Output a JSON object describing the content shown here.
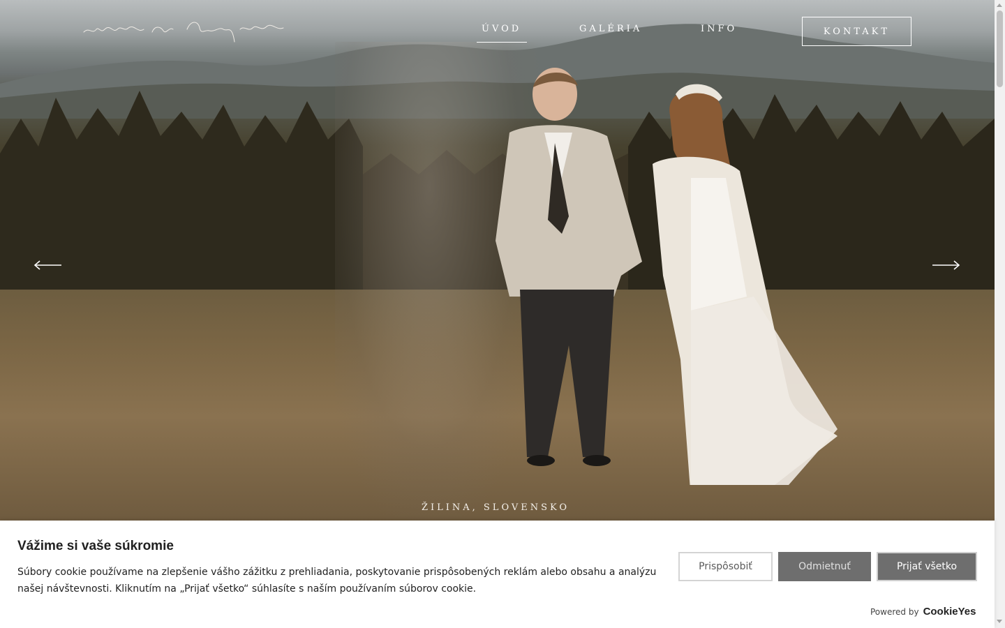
{
  "nav": {
    "logo_text": "marki na bregleu",
    "items": [
      {
        "label": "ÚVOD",
        "active": true
      },
      {
        "label": "GALÉRIA",
        "active": false
      },
      {
        "label": "INFO",
        "active": false
      }
    ],
    "cta": "KONTAKT"
  },
  "hero": {
    "location": "ŽILINA, SLOVENSKO",
    "prev_icon": "arrow-left-icon",
    "next_icon": "arrow-right-icon"
  },
  "cookie": {
    "title": "Vážime si vaše súkromie",
    "text": "Súbory cookie používame na zlepšenie vášho zážitku z prehliadania, poskytovanie prispôsobených reklám alebo obsahu a analýzu našej návštevnosti. Kliknutím na „Prijať všetko“ súhlasíte s naším používaním súborov cookie.",
    "buttons": {
      "customize": "Prispôsobiť",
      "reject": "Odmietnuť",
      "accept": "Prijať všetko"
    },
    "powered_by": "Powered by",
    "brand": "CookieYes"
  },
  "colors": {
    "button_dark": "#6e6e6e",
    "text_dark": "#212121",
    "nav_text": "#ffffff"
  }
}
